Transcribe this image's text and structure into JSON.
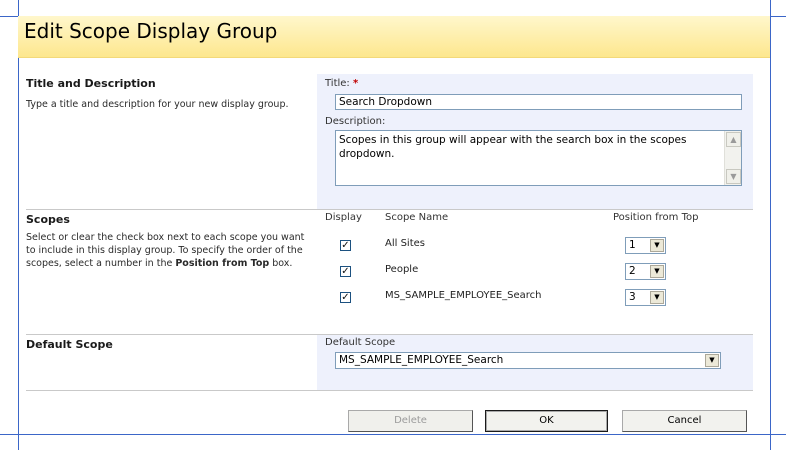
{
  "page": {
    "title": "Edit Scope Display Group"
  },
  "title_section": {
    "heading": "Title and Description",
    "description": "Type a title and description for your new display group.",
    "title_label": "Title:",
    "required_mark": "*",
    "title_value": "Search Dropdown",
    "description_label": "Description:",
    "description_value": "Scopes in this group will appear with the search box in the scopes dropdown."
  },
  "scopes_section": {
    "heading": "Scopes",
    "desc_part1": "Select or clear the check box next to each scope you want to include in this display group. To specify the order of the scopes, select a number in the ",
    "desc_bold": "Position from Top",
    "desc_part2": " box.",
    "col_display": "Display",
    "col_scope_name": "Scope Name",
    "col_position": "Position from Top",
    "rows": [
      {
        "checked": true,
        "name": "All Sites",
        "position": "1"
      },
      {
        "checked": true,
        "name": "People",
        "position": "2"
      },
      {
        "checked": true,
        "name": "MS_SAMPLE_EMPLOYEE_Search",
        "position": "3"
      }
    ]
  },
  "default_section": {
    "heading": "Default Scope",
    "field_label": "Default Scope",
    "selected": "MS_SAMPLE_EMPLOYEE_Search"
  },
  "buttons": {
    "delete": "Delete",
    "ok": "OK",
    "cancel": "Cancel"
  },
  "icons": {
    "check": "checkmark-icon",
    "dropdown": "chevron-down-icon",
    "scroll_up": "scroll-up-arrow-icon",
    "scroll_down": "scroll-down-arrow-icon"
  },
  "colors": {
    "title_bar": "#fde78e",
    "input_panel": "#eef1fc",
    "required": "#c00000",
    "guides": "#3b66c8"
  }
}
